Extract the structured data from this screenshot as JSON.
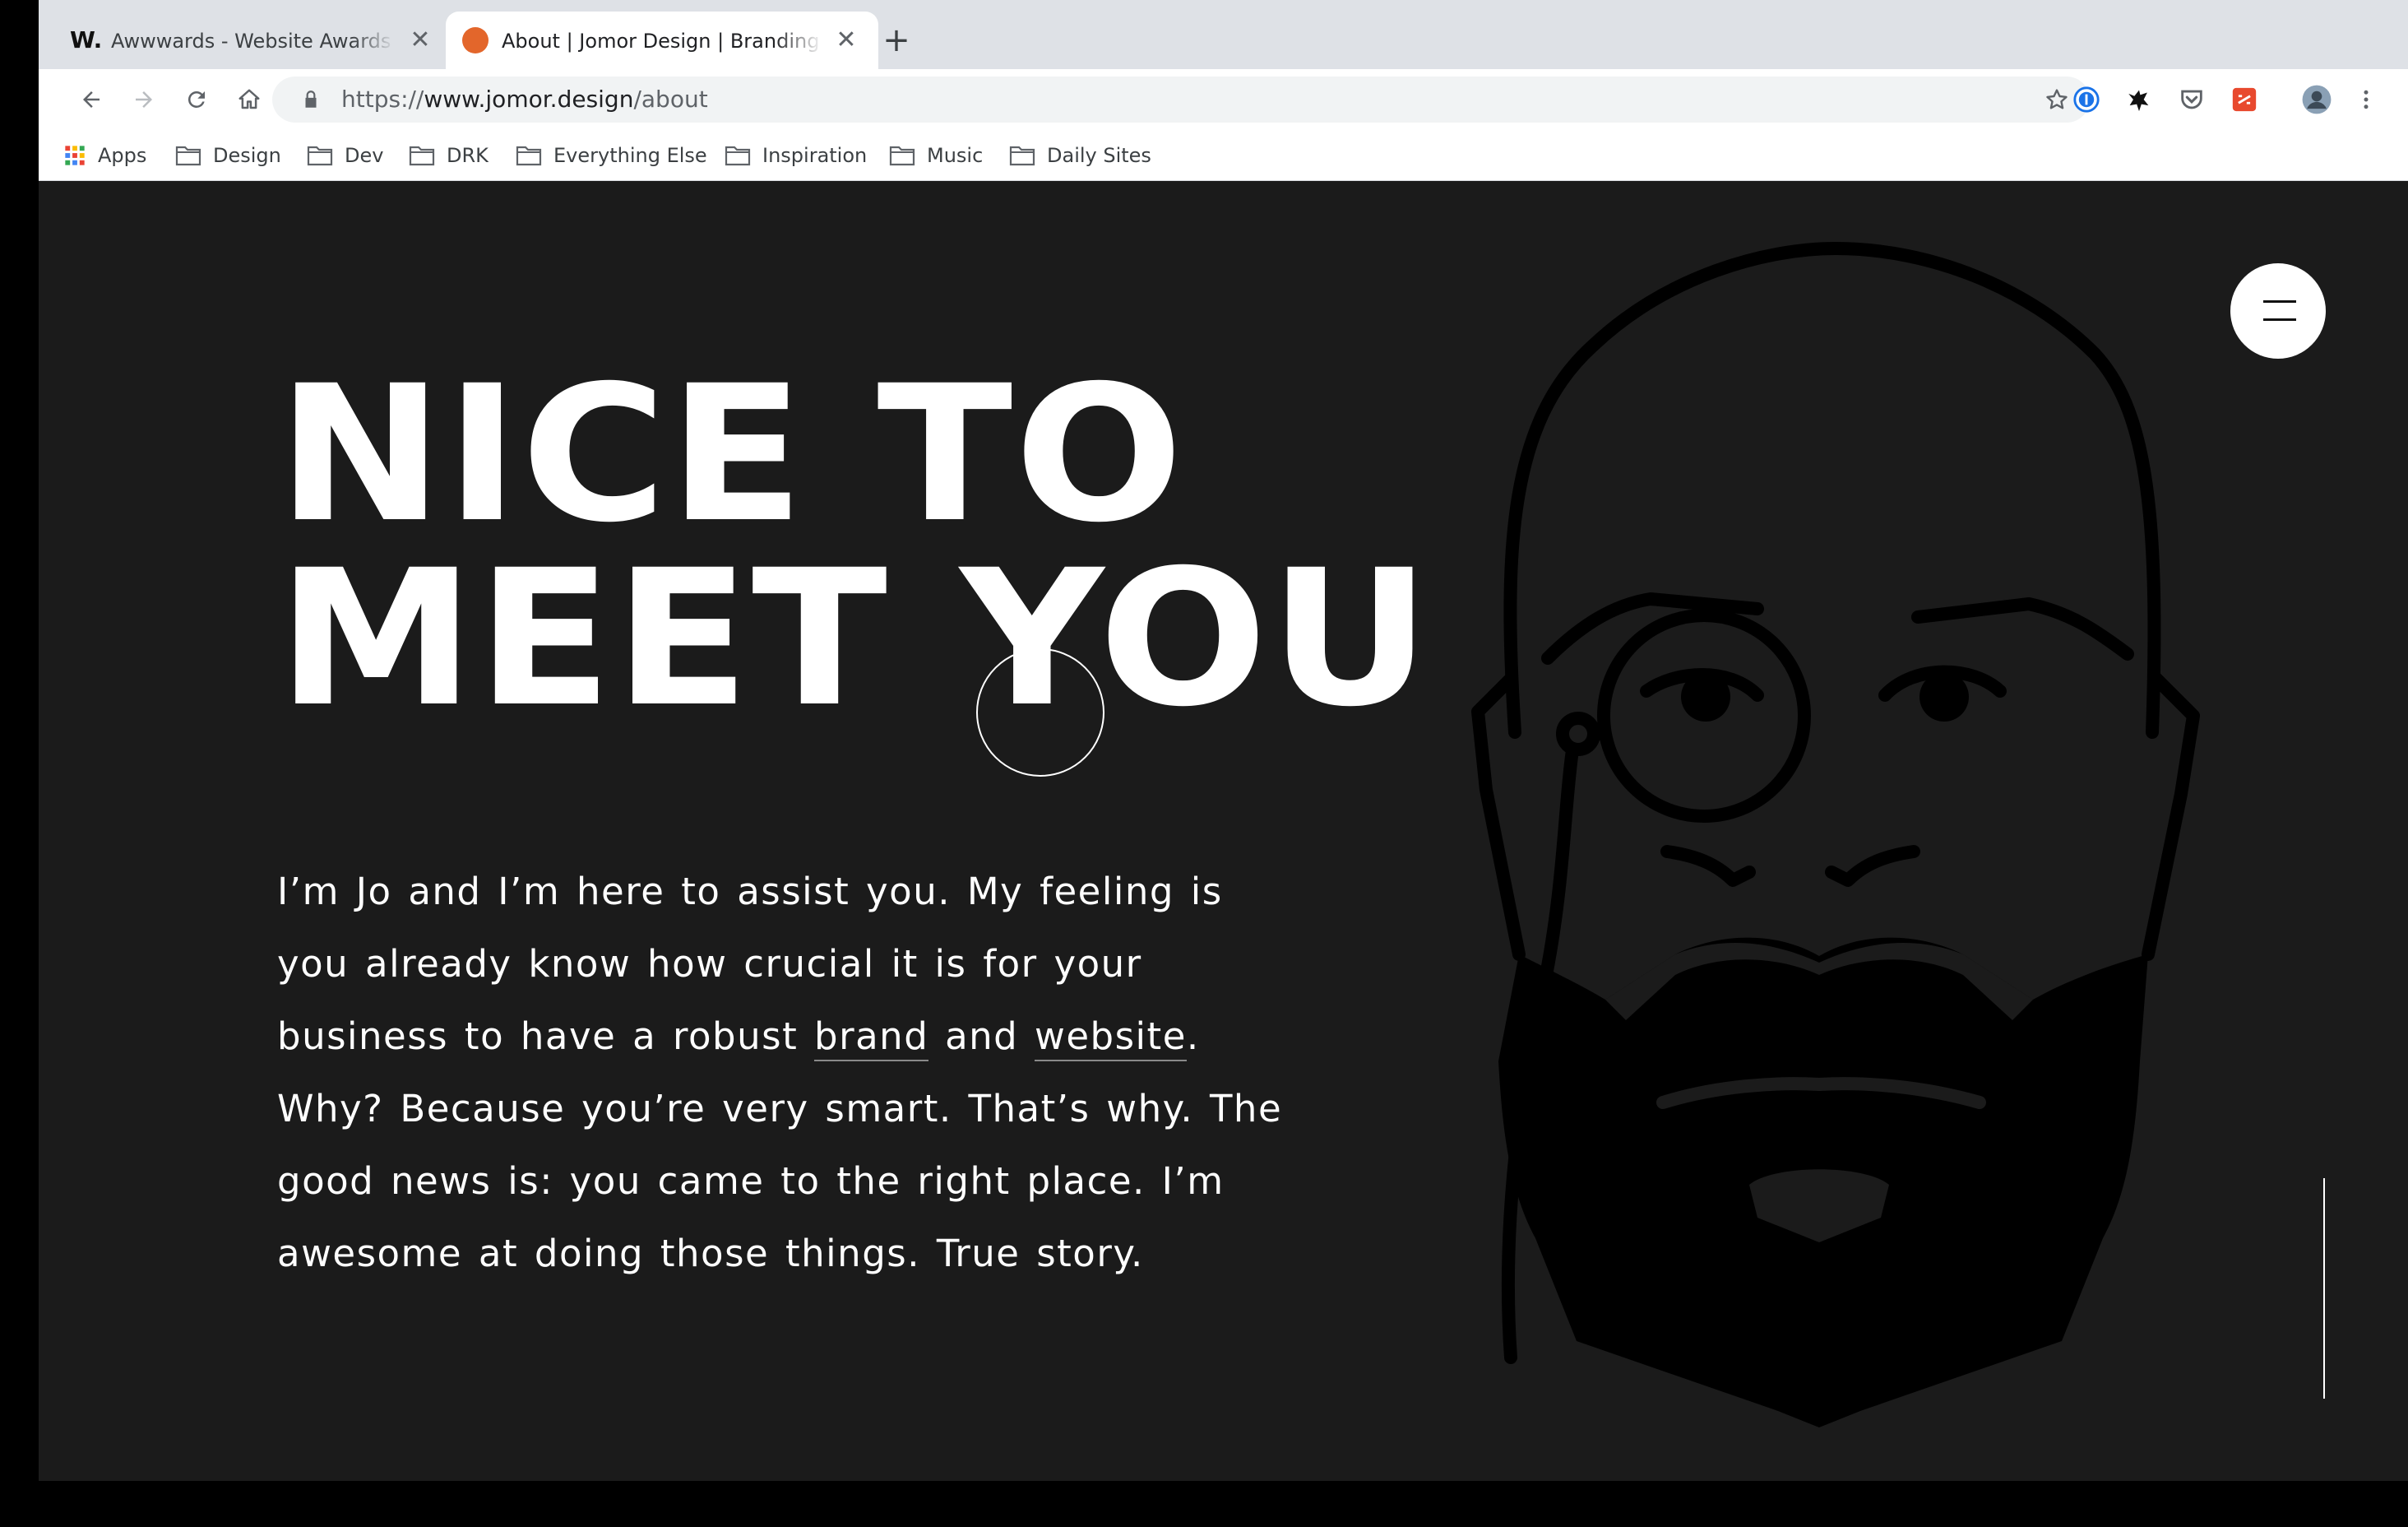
{
  "browser": {
    "tabs": [
      {
        "favicon": "W.",
        "title": "Awwwards - Website Awards - Best Web Design",
        "active": false
      },
      {
        "favicon": "jomor-orange-dot",
        "title": "About | Jomor Design | Branding & Web",
        "active": true
      }
    ],
    "new_tab": "+",
    "close_glyph": "✕",
    "url": {
      "scheme": "https://",
      "host": "www.jomor.design",
      "path": "/about"
    },
    "extensions": [
      "1password-icon",
      "bat-icon",
      "pocket-icon",
      "tagger-icon"
    ],
    "bookmarks": [
      {
        "label": "Apps",
        "icon": "apps-grid-icon"
      },
      {
        "label": "Design",
        "icon": "folder-icon"
      },
      {
        "label": "Dev",
        "icon": "folder-icon"
      },
      {
        "label": "DRK",
        "icon": "folder-icon"
      },
      {
        "label": "Everything Else",
        "icon": "folder-icon"
      },
      {
        "label": "Inspiration",
        "icon": "folder-icon"
      },
      {
        "label": "Music",
        "icon": "folder-icon"
      },
      {
        "label": "Daily Sites",
        "icon": "folder-icon"
      }
    ]
  },
  "page": {
    "headline": [
      "NICE TO",
      "MEET YOU"
    ],
    "intro": {
      "part1": "I’m Jo and I’m here to assist you. My feeling is you already know how crucial it is for your business to have a robust ",
      "link1": "brand",
      "part2": " and ",
      "link2": "website",
      "part3": ". Why? Because you’re very smart. That’s why. The good news is: you came to the right place. I’m awesome at doing those things. True story."
    },
    "menu_icon": "hamburger-icon",
    "illustration": "bearded-man-with-monocle-portrait"
  },
  "colors": {
    "page_bg": "#1b1b1b",
    "text": "#ffffff",
    "favicon_accent": "#e3662b",
    "tabstrip": "#dee1e6"
  }
}
